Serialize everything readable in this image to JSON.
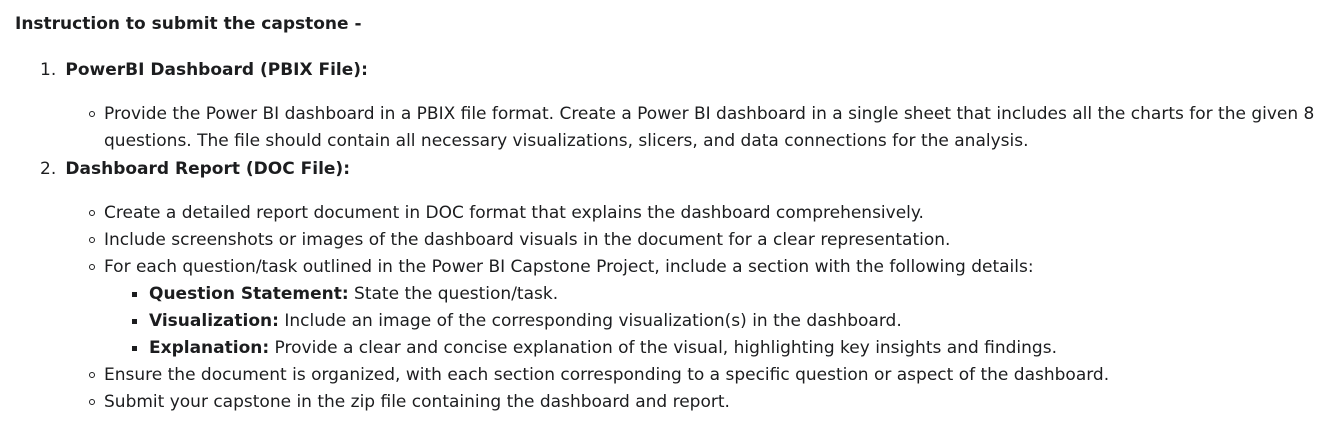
{
  "heading": "Instruction to submit the capstone -",
  "items": [
    {
      "number": "1.",
      "title": "PowerBI Dashboard (PBIX File):",
      "bullets": [
        "Provide the Power BI dashboard in a PBIX file format. Create a Power BI dashboard in a single sheet that includes all the charts for the given 8 questions. The file should contain all necessary visualizations, slicers, and data connections for the analysis."
      ]
    },
    {
      "number": "2.",
      "title": "Dashboard Report (DOC File):",
      "bullets": [
        "Create a detailed report document in DOC format that explains the dashboard comprehensively.",
        "Include screenshots or images of the dashboard visuals in the document for a clear representation.",
        "For each question/task outlined in the Power BI Capstone Project, include a section with the following details:",
        "Ensure the document is organized, with each section corresponding to a specific question or aspect of the dashboard.",
        "Submit your capstone in the zip file containing the dashboard and report."
      ],
      "sub_bullets": [
        {
          "label": "Question Statement:",
          "text": " State the question/task."
        },
        {
          "label": "Visualization:",
          "text": " Include an image of the corresponding visualization(s) in the dashboard."
        },
        {
          "label": "Explanation:",
          "text": " Provide a clear and concise explanation of the visual, highlighting key insights and findings."
        }
      ]
    }
  ]
}
